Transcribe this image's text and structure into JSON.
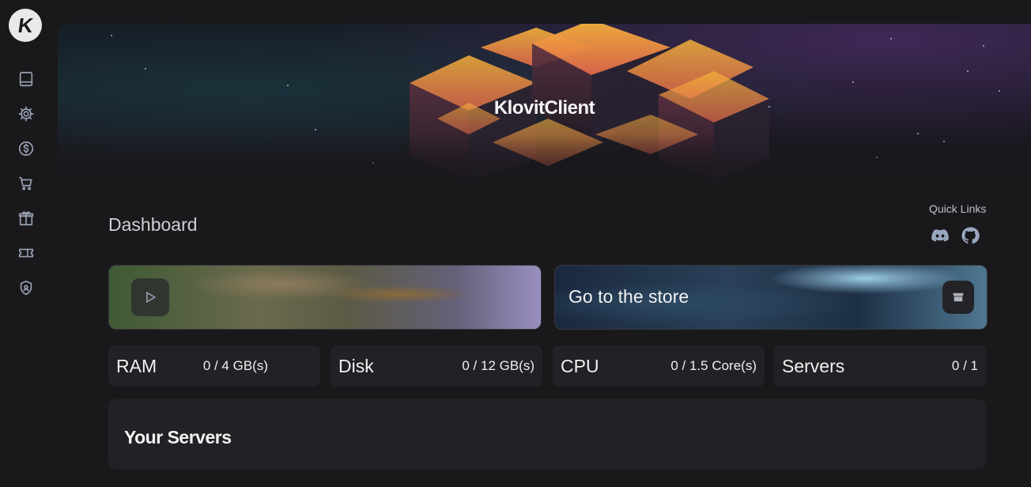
{
  "app": {
    "logo_letter": "K",
    "brand_name": "KlovitClient"
  },
  "sidebar": {
    "items": [
      {
        "name": "book-icon"
      },
      {
        "name": "gear-icon"
      },
      {
        "name": "dollar-icon"
      },
      {
        "name": "cart-icon"
      },
      {
        "name": "gift-icon"
      },
      {
        "name": "ticket-icon"
      },
      {
        "name": "shield-icon"
      }
    ]
  },
  "dashboard": {
    "title": "Dashboard",
    "quick_links": {
      "label": "Quick Links",
      "items": [
        "discord-icon",
        "github-icon"
      ]
    },
    "banners": {
      "play_icon": "play-icon",
      "store_label": "Go to the store",
      "store_icon": "store-icon"
    },
    "stats": [
      {
        "label": "RAM",
        "value": "0 / 4 GB(s)"
      },
      {
        "label": "Disk",
        "value": "0 / 12 GB(s)"
      },
      {
        "label": "CPU",
        "value": "0 / 1.5 Core(s)"
      },
      {
        "label": "Servers",
        "value": "0 / 1"
      }
    ],
    "servers_title": "Your Servers"
  },
  "colors": {
    "background": "#19181b",
    "card": "#222125",
    "icon": "#9aa3b5"
  }
}
